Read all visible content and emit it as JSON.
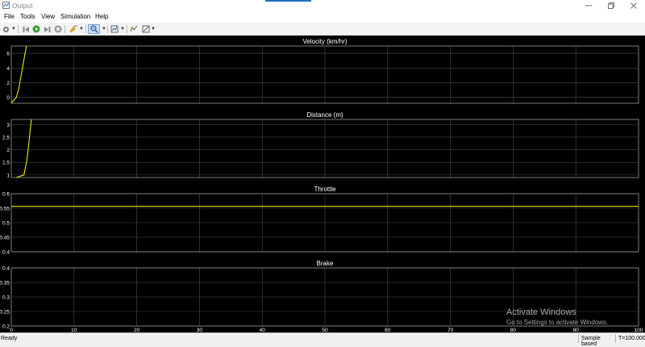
{
  "window": {
    "title": "Output"
  },
  "menu": [
    "File",
    "Tools",
    "View",
    "Simulation",
    "Help"
  ],
  "toolbar": {
    "icons": [
      "settings-icon",
      "step-back-icon",
      "run-icon",
      "step-forward-icon",
      "stop-icon",
      "highlight-icon",
      "zoom-icon",
      "autoscale-icon",
      "signal-selector-icon",
      "measurements-icon"
    ],
    "active": "zoom-icon"
  },
  "colors": {
    "trace": "#ffff00",
    "axes_bg": "#000000",
    "grid": "#4a4a4a",
    "axis": "#9a9a9a",
    "text": "#ffffff",
    "chrome": "#f0f0f0"
  },
  "chart_data": [
    {
      "type": "line",
      "title": "Velocity (km/hr)",
      "xlim": [
        0,
        100
      ],
      "ylim": [
        -0.8,
        7
      ],
      "yticks": [
        "0",
        "2",
        "4",
        "6"
      ],
      "series": [
        {
          "x": [
            0,
            0.8,
            1.2,
            2.4
          ],
          "y": [
            -0.8,
            0.0,
            1.2,
            7.0
          ]
        }
      ]
    },
    {
      "type": "line",
      "title": "Distance (m)",
      "xlim": [
        0,
        100
      ],
      "ylim": [
        0.9,
        3.2
      ],
      "yticks": [
        "1",
        "1.5",
        "2",
        "2.5",
        "3"
      ],
      "series": [
        {
          "x": [
            0.8,
            2.0,
            2.5,
            3.2
          ],
          "y": [
            0.9,
            1.0,
            1.6,
            3.2
          ]
        }
      ]
    },
    {
      "type": "line",
      "title": "Throttle",
      "xlim": [
        0,
        100
      ],
      "ylim": [
        0.4,
        0.6
      ],
      "yticks": [
        "0.4",
        "0.45",
        "0.5",
        "0.55",
        "0.6"
      ],
      "series": [
        {
          "x": [
            0,
            100
          ],
          "y": [
            0.556,
            0.556
          ]
        }
      ]
    },
    {
      "type": "line",
      "title": "Brake",
      "xlim": [
        0,
        100
      ],
      "ylim": [
        0.2,
        0.4
      ],
      "yticks": [
        "0.2",
        "0.25",
        "0.3",
        "0.35",
        "0.4"
      ],
      "xticks": [
        "0",
        "10",
        "20",
        "30",
        "40",
        "50",
        "60",
        "70",
        "80",
        "90",
        "100"
      ],
      "series": []
    }
  ],
  "watermark": {
    "line1": "Activate Windows",
    "line2": "Go to Settings to activate Windows."
  },
  "status": {
    "left": "Ready",
    "mode": "Sample based",
    "time": "T=100.000"
  }
}
